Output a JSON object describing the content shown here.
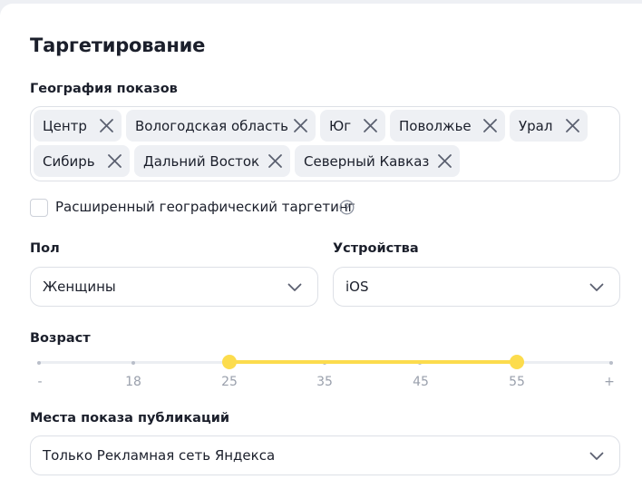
{
  "title": "Таргетирование",
  "geo": {
    "label": "География показов",
    "tags": [
      "Центр",
      "Вологодская область",
      "Юг",
      "Поволжье",
      "Урал",
      "Сибирь",
      "Дальний Восток",
      "Северный Кавказ"
    ]
  },
  "extended_geo": {
    "label": "Расширенный географический таргетинг",
    "checked": false
  },
  "gender": {
    "label": "Пол",
    "value": "Женщины"
  },
  "devices": {
    "label": "Устройства",
    "value": "iOS"
  },
  "age": {
    "label": "Возраст",
    "ticks": [
      "-",
      "18",
      "25",
      "35",
      "45",
      "55",
      "+"
    ],
    "range_from": "25",
    "range_to": "55",
    "accent": "#fcdc4d"
  },
  "placement": {
    "label": "Места показа публикаций",
    "value": "Только Рекламная сеть Яндекса"
  }
}
